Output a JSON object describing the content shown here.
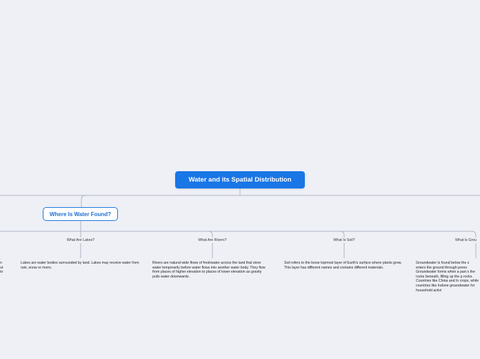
{
  "root": {
    "label": "Water and its Spatial Distribution"
  },
  "branch": {
    "label": "Where Is Water Found?"
  },
  "topics": [
    {
      "title": "What Are Lakes?",
      "description": "Lakes are water bodies surrounded by land. Lakes may receive water from rain, snow or rivers."
    },
    {
      "title": "What Are Rivers?",
      "description": "Rivers are natural wide flows of freshwater across the land that store water temporarily before water flows into another water body. They flow from places of higher elevation to places of lower elevation as gravity pulls water downwards."
    },
    {
      "title": "What Is Soil?",
      "description": "Soil refers to the loose topmost layer of Earth's surface where plants grow. This layer has different names and contains different materials."
    },
    {
      "title": "What Is Grou",
      "description": "Groundwater is found below the s enters the ground through pores Groundwater forms when a part o the rocks beneath, filling up the p rocks. Countries like China and In crops, while countries like Indone groundwater for household activi"
    }
  ],
  "left_fragment": [
    "n",
    "ut",
    "to"
  ],
  "colors": {
    "background": "#eef0f6",
    "root_fill": "#1976e6",
    "branch_border": "#1f77e0",
    "connector": "#aeb4c4"
  }
}
